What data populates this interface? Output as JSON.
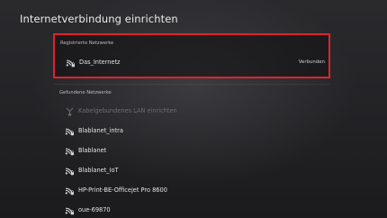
{
  "page": {
    "title": "Internetverbindung einrichten"
  },
  "registered": {
    "header": "Registrierte Netzwerke",
    "networks": [
      {
        "name": "Das_Internetz",
        "status": "Verbunden",
        "icon": "wifi-locked-icon"
      }
    ]
  },
  "found": {
    "header": "Gefundene Netzwerke",
    "networks": [
      {
        "name": "Kabelgebundenes LAN einrichten",
        "icon": "lan-cable-icon",
        "disabled": true
      },
      {
        "name": "Blablanet_intra",
        "icon": "wifi-locked-icon"
      },
      {
        "name": "Blablanet",
        "icon": "wifi-locked-icon"
      },
      {
        "name": "Blablanet_IoT",
        "icon": "wifi-locked-icon"
      },
      {
        "name": "HP-Print-BE-Officejet Pro 8600",
        "icon": "wifi-locked-icon"
      },
      {
        "name": "oue-69870",
        "icon": "wifi-locked-icon"
      }
    ]
  },
  "colors": {
    "selection_border": "#e0232c",
    "background": "#232326"
  }
}
